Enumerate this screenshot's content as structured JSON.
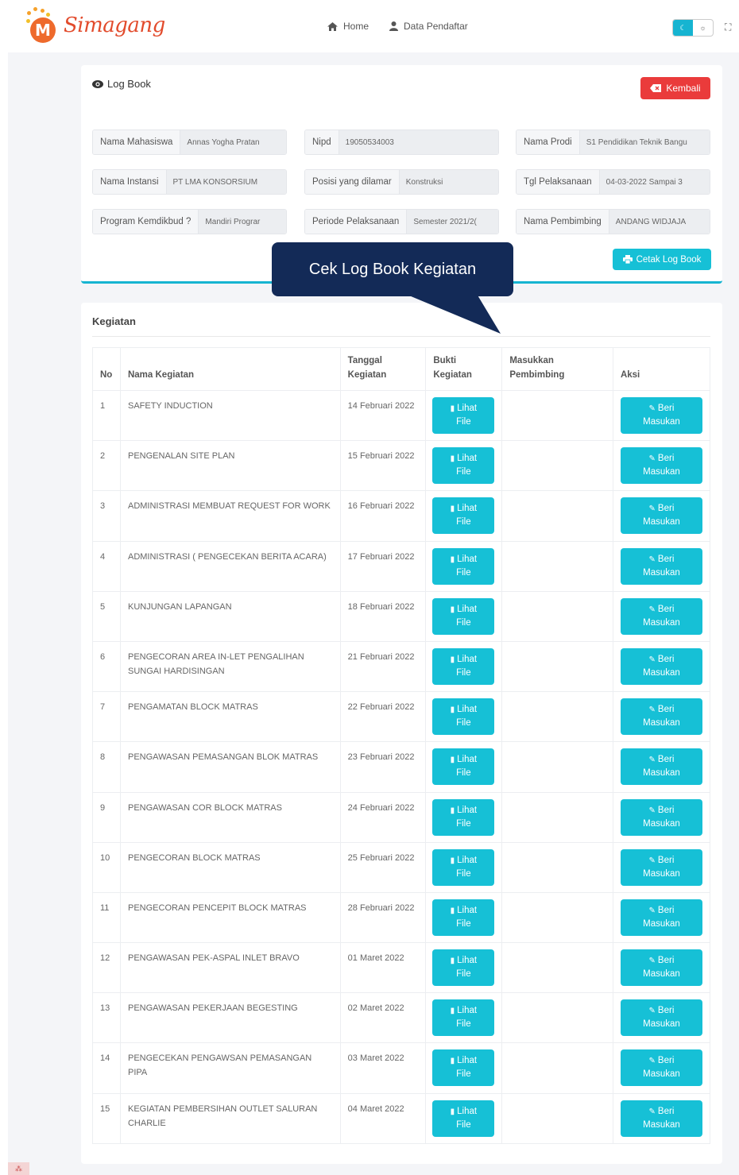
{
  "app": {
    "logo_letter": "M",
    "logo_text": "Simagang"
  },
  "nav": {
    "items": [
      {
        "icon": "home-icon",
        "label": "Home"
      },
      {
        "icon": "user-icon",
        "label": "Data Pendaftar"
      }
    ]
  },
  "logbook": {
    "title": "Log Book",
    "back_label": "Kembali",
    "print_label": "Cetak Log Book",
    "fields": {
      "nama_mahasiswa": {
        "label": "Nama Mahasiswa",
        "value": "Annas Yogha Pratan"
      },
      "nipd": {
        "label": "Nipd",
        "value": "19050534003"
      },
      "nama_prodi": {
        "label": "Nama Prodi",
        "value": "S1 Pendidikan Teknik Bangu"
      },
      "nama_instansi": {
        "label": "Nama Instansi",
        "value": "PT LMA KONSORSIUM"
      },
      "posisi": {
        "label": "Posisi yang dilamar",
        "value": "Konstruksi"
      },
      "tgl": {
        "label": "Tgl Pelaksanaan",
        "value": "04-03-2022 Sampai 3"
      },
      "program": {
        "label": "Program Kemdikbud ?",
        "value": "Mandiri Prograr"
      },
      "periode": {
        "label": "Periode Pelaksanaan",
        "value": "Semester 2021/2("
      },
      "pembimbing": {
        "label": "Nama Pembimbing",
        "value": "ANDANG WIDJAJA"
      }
    }
  },
  "callout": {
    "text": "Cek Log Book Kegiatan"
  },
  "kegiatan": {
    "title": "Kegiatan",
    "headers": {
      "no": "No",
      "nama": "Nama Kegiatan",
      "tanggal": "Tanggal Kegiatan",
      "bukti": "Bukti Kegiatan",
      "masukan": "Masukkan Pembimbing",
      "aksi": "Aksi"
    },
    "file_button": {
      "line1": "Lihat",
      "line2": "File"
    },
    "action_button": {
      "line1": "Beri",
      "line2": "Masukan"
    },
    "rows": [
      {
        "no": "1",
        "nama": "SAFETY INDUCTION",
        "tanggal": "14 Februari 2022",
        "masukan": ""
      },
      {
        "no": "2",
        "nama": "PENGENALAN SITE PLAN",
        "tanggal": "15 Februari 2022",
        "masukan": ""
      },
      {
        "no": "3",
        "nama": "ADMINISTRASI MEMBUAT REQUEST FOR WORK",
        "tanggal": "16 Februari 2022",
        "masukan": ""
      },
      {
        "no": "4",
        "nama": "ADMINISTRASI ( PENGECEKAN BERITA ACARA)",
        "tanggal": "17 Februari 2022",
        "masukan": ""
      },
      {
        "no": "5",
        "nama": "KUNJUNGAN LAPANGAN",
        "tanggal": "18 Februari 2022",
        "masukan": ""
      },
      {
        "no": "6",
        "nama": "PENGECORAN AREA IN-LET PENGALIHAN SUNGAI HARDISINGAN",
        "tanggal": "21 Februari 2022",
        "masukan": ""
      },
      {
        "no": "7",
        "nama": "PENGAMATAN BLOCK MATRAS",
        "tanggal": "22 Februari 2022",
        "masukan": ""
      },
      {
        "no": "8",
        "nama": "PENGAWASAN PEMASANGAN BLOK MATRAS",
        "tanggal": "23 Februari 2022",
        "masukan": ""
      },
      {
        "no": "9",
        "nama": "PENGAWASAN COR BLOCK MATRAS",
        "tanggal": "24 Februari 2022",
        "masukan": ""
      },
      {
        "no": "10",
        "nama": "PENGECORAN BLOCK MATRAS",
        "tanggal": "25 Februari 2022",
        "masukan": ""
      },
      {
        "no": "11",
        "nama": "PENGECORAN PENCEPIT BLOCK MATRAS",
        "tanggal": "28 Februari 2022",
        "masukan": ""
      },
      {
        "no": "12",
        "nama": "PENGAWASAN PEK-ASPAL INLET BRAVO",
        "tanggal": "01 Maret 2022",
        "masukan": ""
      },
      {
        "no": "13",
        "nama": "PENGAWASAN PEKERJAAN BEGESTING",
        "tanggal": "02 Maret 2022",
        "masukan": ""
      },
      {
        "no": "14",
        "nama": "PENGECEKAN PENGAWSAN PEMASANGAN PIPA",
        "tanggal": "03 Maret 2022",
        "masukan": ""
      },
      {
        "no": "15",
        "nama": "KEGIATAN PEMBERSIHAN OUTLET SALURAN CHARLIE",
        "tanggal": "04 Maret 2022",
        "masukan": ""
      }
    ]
  },
  "colors": {
    "accent": "#16c0d6",
    "danger": "#ea3b3b",
    "callout": "#132a57",
    "brand": "#e24b2c"
  }
}
